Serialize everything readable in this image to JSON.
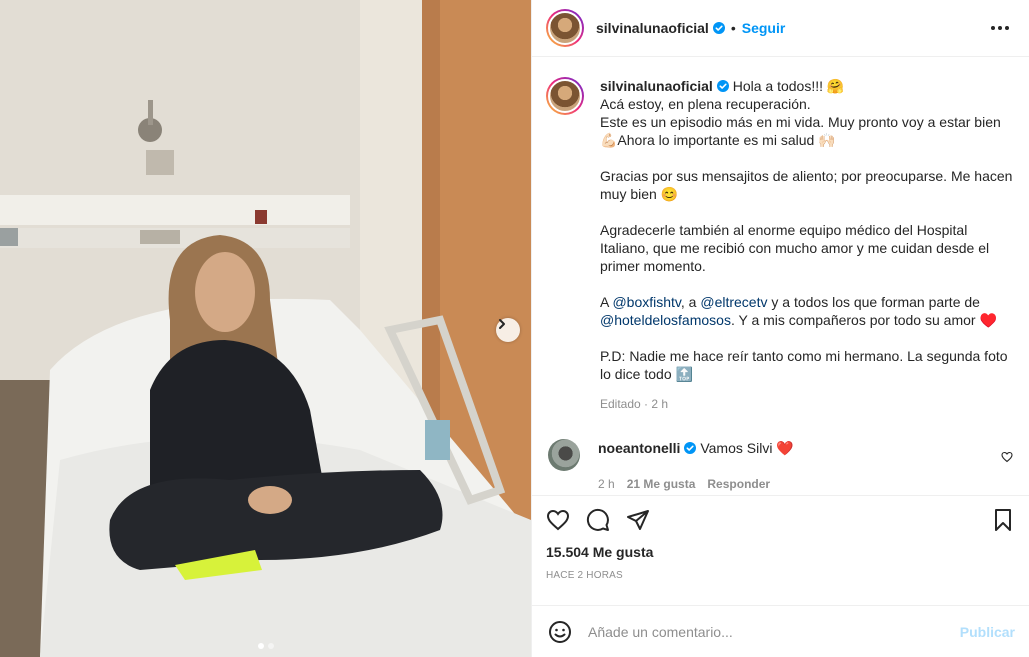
{
  "header": {
    "username": "silvinalunaoficial",
    "separator": "•",
    "follow_label": "Seguir",
    "more_icon": "more-horizontal-icon"
  },
  "caption": {
    "username": "silvinalunaoficial",
    "lines": [
      "Hola a todos!!! 🤗",
      "Acá estoy, en plena recuperación.",
      "Este es un episodio más en mi vida. Muy pronto voy a estar bien 💪🏻Ahora lo importante es mi salud 🙌🏻"
    ],
    "para2": "Gracias por sus mensajitos de aliento; por preocuparse. Me hacen muy bien 😊",
    "para3": "Agradecerle también al enorme equipo médico del Hospital Italiano, que me recibió con mucho amor y me cuidan desde el primer momento.",
    "para4": {
      "pre": "A ",
      "mention1": "@boxfishtv",
      "mid1": ", a ",
      "mention2": "@eltrecetv",
      "mid2": " y a todos los que forman parte de ",
      "mention3": "@hoteldelosfamosos",
      "post": ". Y a mis compañeros por todo su amor ♥️"
    },
    "para5": "P.D: Nadie me hace reír tanto como mi hermano. La segunda foto lo dice todo 🔝",
    "meta": "Editado · 2 h"
  },
  "comment": {
    "username": "noeantonelli",
    "text": "Vamos Silvi ❤️",
    "time": "2 h",
    "likes": "21 Me gusta",
    "reply_label": "Responder"
  },
  "actions": {
    "likes": "15.504 Me gusta",
    "timestamp": "HACE 2 HORAS"
  },
  "add_comment": {
    "placeholder": "Añade un comentario...",
    "post_label": "Publicar"
  },
  "colors": {
    "accent": "#0095f6",
    "mention": "#00376b",
    "muted": "#8e8e8e",
    "post_disabled": "#b2dffc",
    "heart": "#ed4956"
  },
  "carousel": {
    "slide_count": 2,
    "active_index": 0
  }
}
